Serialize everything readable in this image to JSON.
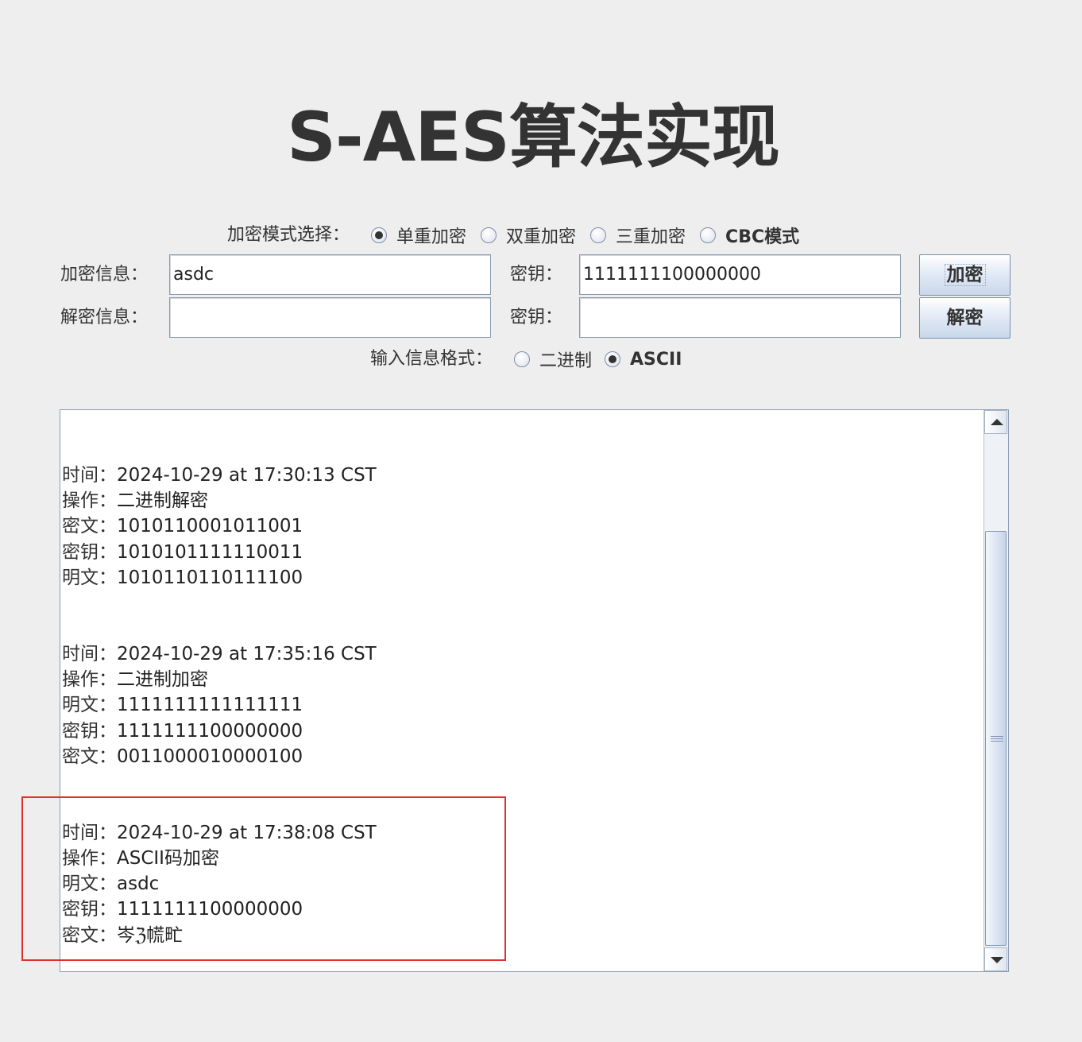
{
  "title": "S-AES算法实现",
  "mode": {
    "label": "加密模式选择：",
    "options": [
      {
        "label": "单重加密",
        "checked": true
      },
      {
        "label": "双重加密",
        "checked": false
      },
      {
        "label": "三重加密",
        "checked": false
      },
      {
        "label": "CBC模式",
        "checked": false
      }
    ]
  },
  "encrypt": {
    "label": "加密信息：",
    "value": "asdc",
    "key_label": "密钥：",
    "key_value": "1111111100000000",
    "button": "加密"
  },
  "decrypt": {
    "label": "解密信息：",
    "value": "",
    "key_label": "密钥：",
    "key_value": "",
    "button": "解密"
  },
  "format": {
    "label": "输入信息格式：",
    "options": [
      {
        "label": "二进制",
        "checked": false
      },
      {
        "label": "ASCII",
        "checked": true
      }
    ]
  },
  "log": [
    {
      "lines": [
        {
          "key": "时间：",
          "value": "2024-10-29 at 17:30:13 CST"
        },
        {
          "key": "操作：",
          "value": "二进制解密"
        },
        {
          "key": "密文：",
          "value": "1010110001011001"
        },
        {
          "key": "密钥：",
          "value": "1010101111110011"
        },
        {
          "key": "明文：",
          "value": "1010110110111100"
        }
      ]
    },
    {
      "lines": [
        {
          "key": "时间：",
          "value": "2024-10-29 at 17:35:16 CST"
        },
        {
          "key": "操作：",
          "value": "二进制加密"
        },
        {
          "key": "明文：",
          "value": "1111111111111111"
        },
        {
          "key": "密钥：",
          "value": "1111111100000000"
        },
        {
          "key": "密文：",
          "value": "0011000010000100"
        }
      ]
    },
    {
      "lines": [
        {
          "key": "时间：",
          "value": "2024-10-29 at 17:38:08 CST"
        },
        {
          "key": "操作：",
          "value": "ASCII码加密"
        },
        {
          "key": "明文：",
          "value": "asdc"
        },
        {
          "key": "密钥：",
          "value": "1111111100000000"
        },
        {
          "key": "密文：",
          "value": "岑ℨ㡛甿"
        }
      ]
    }
  ],
  "colors": {
    "background": "#eeeeee",
    "highlight_border": "#e0312f"
  }
}
